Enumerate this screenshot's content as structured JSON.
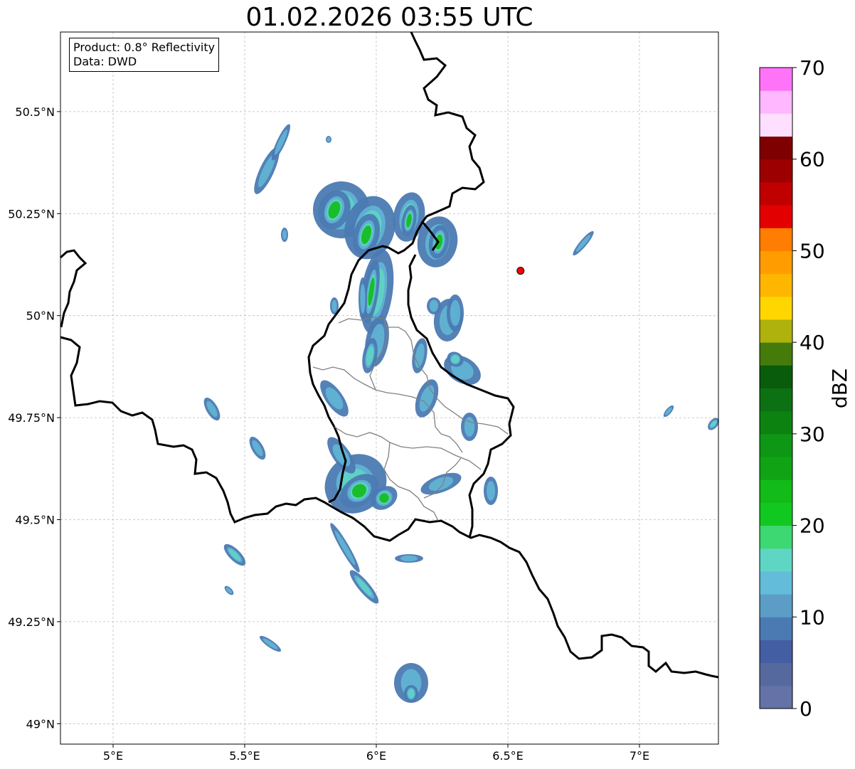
{
  "title": "01.02.2026 03:55 UTC",
  "info": {
    "product": "Product: 0.8° Reflectivity",
    "source": "Data: DWD"
  },
  "axes": {
    "x_ticks": [
      "5°E",
      "5.5°E",
      "6°E",
      "6.5°E",
      "7°E"
    ],
    "y_ticks": [
      "50.5°N",
      "50.25°N",
      "50°N",
      "49.75°N",
      "49.5°N",
      "49.25°N",
      "49°N"
    ]
  },
  "colorbar": {
    "label": "dBZ",
    "ticks": [
      "0",
      "10",
      "20",
      "30",
      "40",
      "50",
      "60",
      "70"
    ],
    "colors": [
      "#6472a8",
      "#56699f",
      "#445ea4",
      "#4b7ab2",
      "#5b9dc7",
      "#63bcd9",
      "#5fd6c4",
      "#3dd871",
      "#11c820",
      "#12bb18",
      "#10a415",
      "#0e9714",
      "#0c8211",
      "#0b7112",
      "#085c0b",
      "#447b0b",
      "#afb10d",
      "#ffd600",
      "#ffb600",
      "#ff9c00",
      "#ff7d00",
      "#e20000",
      "#c00000",
      "#9d0000",
      "#7f0000",
      "#ffdfff",
      "#ffb7ff",
      "#ff73f9",
      "#ea38ea"
    ]
  },
  "site_marker": {
    "lon": 6.548,
    "lat": 50.11,
    "color": "#ff0000"
  }
}
